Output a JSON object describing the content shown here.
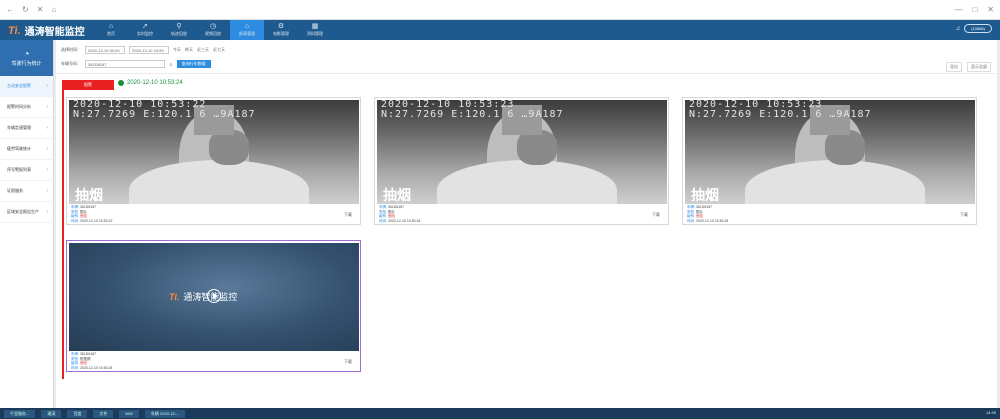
{
  "browser": {
    "nav": [
      "←",
      "↻",
      "✕",
      "⌂"
    ],
    "window_controls": [
      "—",
      "□",
      "✕"
    ]
  },
  "app": {
    "logo_mark": "Ti.",
    "title": "通涛智能监控"
  },
  "topnav": [
    {
      "icon": "⌂",
      "label": "首页"
    },
    {
      "icon": "➚",
      "label": "实时监控"
    },
    {
      "icon": "⚲",
      "label": "轨迹回放"
    },
    {
      "icon": "◷",
      "label": "视频回放"
    },
    {
      "icon": "⌂",
      "label": "报表管理"
    },
    {
      "icon": "⚙",
      "label": "电影管理"
    },
    {
      "icon": "▦",
      "label": "资料管理"
    }
  ],
  "user": {
    "bell": "♫",
    "button": "(10888)"
  },
  "sidebar": {
    "header": "驾驶行为统计",
    "items": [
      {
        "label": "主动安全报警",
        "active": true
      },
      {
        "label": "报警时间分析",
        "active": false
      },
      {
        "label": "车辆定速管理",
        "active": false
      },
      {
        "label": "疲劳驾驶统计",
        "active": false
      },
      {
        "label": "序号警报列表",
        "active": false
      },
      {
        "label": "证照服务",
        "active": false
      },
      {
        "label": "区域安全报告生产",
        "active": false
      }
    ]
  },
  "filters": {
    "time_label": "选择时间：",
    "start": "2020-12-10 00:00",
    "end": "2020-12-10 23:59",
    "quick": [
      "今天",
      "昨天",
      "近三天",
      "近七天"
    ],
    "vehicle_label": "车辆号码：",
    "vehicle": "361D6187",
    "query": "查询行车数据",
    "tools": [
      "导出",
      "显示全部"
    ]
  },
  "event": {
    "flag": "报警",
    "time": "2020-12-10 10:53:24"
  },
  "cards": [
    {
      "osd1": "2020-12-10 10:53:22",
      "osd2": "N:27.7269 E:120.1 6 …9A187",
      "alarm": "抽烟",
      "plate": "361D6187",
      "type": "图片",
      "level": "危险",
      "time": "2020-12-10 10:53:22",
      "download": "下载"
    },
    {
      "osd1": "2020-12-10 10:53:23",
      "osd2": "N:27.7269 E:120.1 6 …9A187",
      "alarm": "抽烟",
      "plate": "361D6187",
      "type": "图片",
      "level": "危险",
      "time": "2020-12-10 10:53:24",
      "download": "下载"
    },
    {
      "osd1": "2020-12-10 10:53:23",
      "osd2": "N:27.7269 E:120.1 6 …9A187",
      "alarm": "抽烟",
      "plate": "361D6187",
      "type": "图片",
      "level": "危险",
      "time": "2020-12-10 10:53:24",
      "download": "下载"
    }
  ],
  "video_card": {
    "logo_mark": "Ti.",
    "logo_text": "通涛智能监控",
    "plate": "361D6187",
    "type": "短视频",
    "level": "危险",
    "time": "2020-12-10 10:53:24",
    "download": "下载"
  },
  "meta_keys": {
    "plate": "车牌:",
    "type": "类型:",
    "level": "级别:",
    "time": "时间:"
  },
  "taskbar": {
    "items": [
      "千里服务...",
      "通涛",
      "百度",
      "文件",
      "WW",
      "车辆 2020-12-..."
    ],
    "clock": "14:39"
  }
}
